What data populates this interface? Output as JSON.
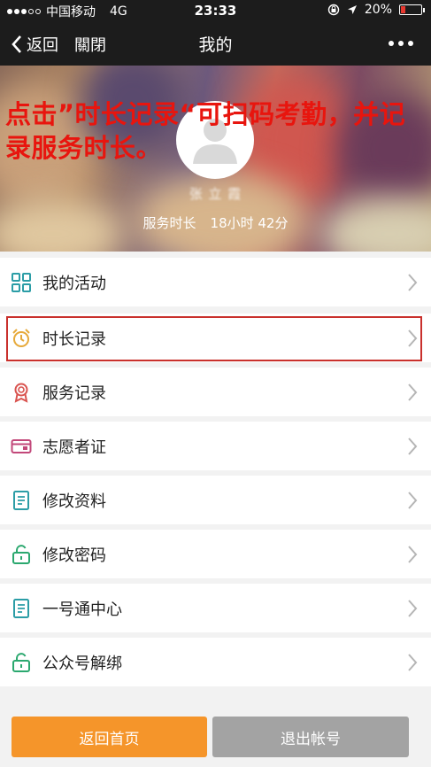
{
  "status_bar": {
    "carrier": "中国移动",
    "network": "4G",
    "time": "23:33",
    "battery": "20%",
    "battery_level": 0.2
  },
  "nav": {
    "back_label": "返回",
    "close_label": "關閉",
    "title": "我的"
  },
  "profile": {
    "username": "张 立 霞",
    "hours_label": "服务时长",
    "hours_value": "18小时 42分"
  },
  "annotation": {
    "text": "点击”时长记录“可扫码考勤，并记录服务时长。"
  },
  "menu": [
    {
      "label": "我的活动",
      "icon": "grid-icon"
    },
    {
      "label": "时长记录",
      "icon": "alarm-clock-icon"
    },
    {
      "label": "服务记录",
      "icon": "award-ribbon-icon"
    },
    {
      "label": "志愿者证",
      "icon": "id-card-icon"
    },
    {
      "label": "修改资料",
      "icon": "document-icon"
    },
    {
      "label": "修改密码",
      "icon": "unlock-icon"
    },
    {
      "label": "一号通中心",
      "icon": "document-icon"
    },
    {
      "label": "公众号解绑",
      "icon": "unlock-icon"
    }
  ],
  "buttons": {
    "home": "返回首页",
    "logout": "退出帐号"
  },
  "colors": {
    "accent_orange": "#f5952a",
    "annotation_red": "#e8150e",
    "icon_teal": "#2b9da6",
    "highlight_border": "#c9302c"
  }
}
